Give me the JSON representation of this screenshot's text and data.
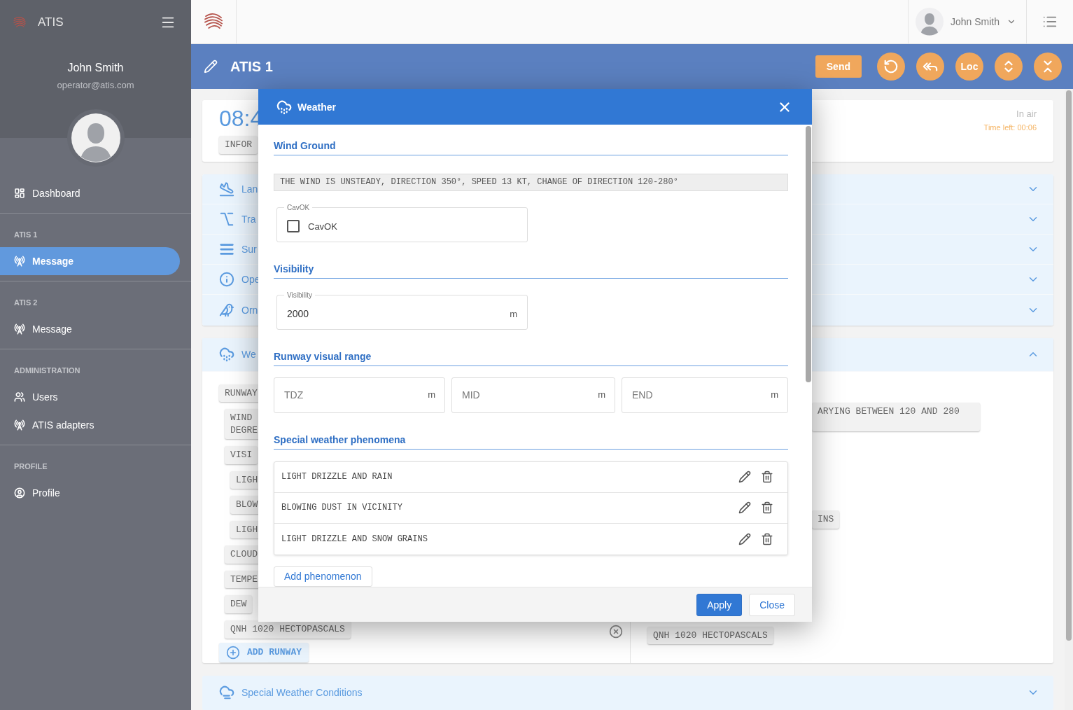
{
  "sidebar": {
    "brand": "ATIS",
    "user_name": "John Smith",
    "user_email": "operator@atis.com",
    "sections": [
      {
        "items": [
          {
            "label": "Dashboard",
            "kind": "dashboard",
            "selected": false
          }
        ]
      },
      {
        "title": "ATIS 1",
        "items": [
          {
            "label": "Message",
            "kind": "antenna",
            "selected": true
          }
        ]
      },
      {
        "title": "ATIS 2",
        "items": [
          {
            "label": "Message",
            "kind": "antenna",
            "selected": false
          }
        ]
      },
      {
        "title": "ADMINISTRATION",
        "items": [
          {
            "label": "Users",
            "kind": "users",
            "selected": false
          },
          {
            "label": "ATIS adapters",
            "kind": "antenna",
            "selected": false
          }
        ]
      },
      {
        "title": "PROFILE",
        "items": [
          {
            "label": "Profile",
            "kind": "account",
            "selected": false
          }
        ]
      }
    ]
  },
  "topbar": {
    "user_name": "John Smith"
  },
  "header": {
    "title": "ATIS 1",
    "actions": [
      {
        "kind": "text",
        "label": "Send"
      },
      {
        "kind": "reset"
      },
      {
        "kind": "reply-all"
      },
      {
        "kind": "round-text",
        "label": "Loc"
      },
      {
        "kind": "expand"
      },
      {
        "kind": "collapse"
      }
    ]
  },
  "status_card": {
    "time": "08:4",
    "chip": "INFOR",
    "state": "In air",
    "time_left": "Time left: 00:06"
  },
  "panels": [
    {
      "kind": "landing",
      "label": "Lan",
      "expanded": false
    },
    {
      "kind": "transition",
      "label": "Tra",
      "expanded": false
    },
    {
      "kind": "surface",
      "label": "Sur",
      "expanded": false
    },
    {
      "kind": "info",
      "label": "Ope",
      "expanded": false
    },
    {
      "kind": "bird",
      "label": "Orn",
      "expanded": false
    }
  ],
  "weather_panel": {
    "label": "We",
    "expanded": true,
    "runway": {
      "text": "RUNWAY",
      "children": [
        {
          "text": "WIND\nDEGRE"
        },
        {
          "text": "VISI",
          "children": [
            {
              "text": "LIGH"
            },
            {
              "text": "BLOW"
            },
            {
              "text": "LIGH"
            }
          ]
        },
        {
          "text": "CLOUD"
        },
        {
          "text": "TEMPE"
        },
        {
          "text": "DEW"
        },
        {
          "text": "QNH 1020 HECTOPASCALS"
        }
      ]
    },
    "right_chips": [
      {
        "text": "ARYING BETWEEN 120 AND 280",
        "kind": "tall"
      },
      {
        "text": "INS",
        "kind": "short"
      },
      {
        "text": "QNH 1020 HECTOPASCALS",
        "kind": "short"
      }
    ],
    "add_button": "ADD RUNWAY"
  },
  "special_panel": {
    "label": "Special Weather Conditions",
    "expanded": false
  },
  "dialog": {
    "title": "Weather",
    "wind_ground": {
      "heading": "Wind Ground",
      "summary": "THE WIND IS UNSTEADY, DIRECTION 350°, SPEED 13 KT, CHANGE OF DIRECTION 120-280°",
      "cavok": {
        "legend": "CavOK",
        "label": "CavOK",
        "checked": false
      }
    },
    "visibility": {
      "heading": "Visibility",
      "legend": "Visibility",
      "value": "2000",
      "unit": "m"
    },
    "rvr": {
      "heading": "Runway visual range",
      "fields": [
        {
          "placeholder": "TDZ",
          "unit": "m"
        },
        {
          "placeholder": "MID",
          "unit": "m"
        },
        {
          "placeholder": "END",
          "unit": "m"
        }
      ]
    },
    "phenomena": {
      "heading": "Special weather phenomena",
      "items": [
        "LIGHT DRIZZLE AND RAIN",
        "BLOWING DUST IN VICINITY",
        "LIGHT DRIZZLE AND SNOW GRAINS"
      ],
      "add_label": "Add phenomenon"
    },
    "buttons": [
      {
        "label": "Apply",
        "kind": "primary"
      },
      {
        "label": "Close",
        "kind": "secondary"
      }
    ]
  }
}
